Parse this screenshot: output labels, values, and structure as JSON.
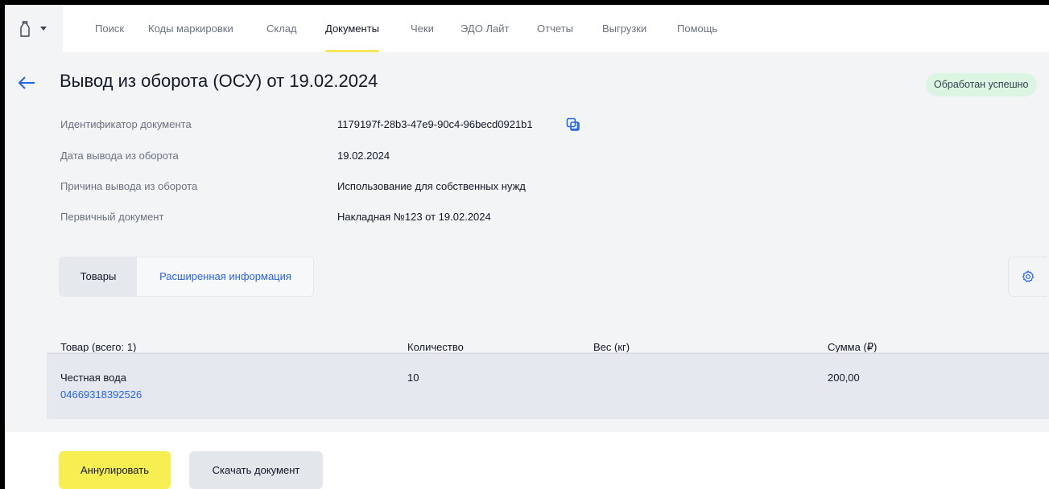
{
  "nav": {
    "items": [
      {
        "label": "Поиск",
        "active": false
      },
      {
        "label": "Коды маркировки",
        "active": false
      },
      {
        "label": "Склад",
        "active": false
      },
      {
        "label": "Документы",
        "active": true
      },
      {
        "label": "Чеки",
        "active": false
      },
      {
        "label": "ЭДО Лайт",
        "active": false
      },
      {
        "label": "Отчеты",
        "active": false
      },
      {
        "label": "Выгрузки",
        "active": false
      },
      {
        "label": "Помощь",
        "active": false
      }
    ]
  },
  "header": {
    "title": "Вывод из оборота (ОСУ) от 19.02.2024",
    "status": "Обработан успешно"
  },
  "details": [
    {
      "label": "Идентификатор документа",
      "value": "1179197f-28b3-47e9-90c4-96becd0921b1"
    },
    {
      "label": "Дата вывода из оборота",
      "value": "19.02.2024"
    },
    {
      "label": "Причина вывода из оборота",
      "value": "Использование для собственных нужд"
    },
    {
      "label": "Первичный документ",
      "value": "Накладная №123 от 19.02.2024"
    }
  ],
  "tabs": [
    {
      "label": "Товары",
      "active": true
    },
    {
      "label": "Расширенная информация",
      "active": false
    }
  ],
  "table": {
    "columns": [
      "Товар (всего: 1)",
      "Количество",
      "Вес (кг)",
      "Сумма (₽)"
    ],
    "rows": [
      {
        "name": "Честная вода",
        "code": "04669318392526",
        "quantity": "10",
        "weight": "",
        "sum": "200,00"
      }
    ]
  },
  "footer": {
    "cancel_label": "Аннулировать",
    "download_label": "Скачать документ"
  },
  "colors": {
    "accent_yellow": "#f7ee52",
    "link_blue": "#2563eb",
    "status_green_bg": "#dcf5e3"
  }
}
